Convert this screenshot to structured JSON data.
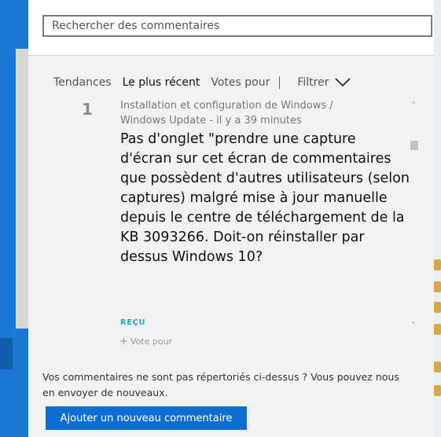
{
  "search": {
    "placeholder": "Rechercher des commentaires"
  },
  "tabs": [
    {
      "label": "Tendances"
    },
    {
      "label": "Le plus récent"
    },
    {
      "label": "Votes pour"
    }
  ],
  "filter": {
    "label": "Filtrer"
  },
  "item": {
    "vote_count": "1",
    "category_line1": "Installation et configuration de Windows /",
    "category_line2": "Windows Update - il y a 39 minutes",
    "title": "Pas d'onglet \"prendre une capture d'écran sur cet écran de commentaires que possèdent  d'autres utilisateurs (selon captures) malgré mise à jour manuelle depuis le centre de téléchargement de la KB 3093266. Doit-on réinstaller par dessus Windows 10?",
    "status": "REÇU",
    "vote_button": "Vote pour"
  },
  "footer": {
    "text": "Vos commentaires ne sont pas répertoriés ci-dessus ? Vous pouvez nous en envoyer de nouveaux.",
    "add_button": "Ajouter un nouveau commentaire"
  },
  "colors": {
    "accent": "#0f6fd1",
    "status": "#2aa5c7",
    "desktop_blue": "#1b78d2"
  }
}
